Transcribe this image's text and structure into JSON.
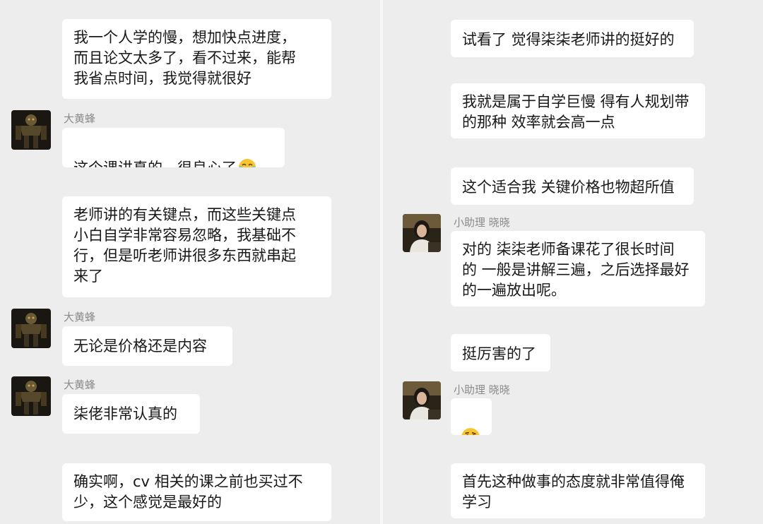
{
  "left": {
    "messages": [
      {
        "text": "我一个人学的慢，想加快点进度，\n而且论文太多了，看不过来，能帮\n我省点时间，我觉得就很好"
      },
      {
        "sender": "大黄蜂",
        "text": "这个课讲真的，很良心了",
        "emoji": "laughing-tears-emoji"
      },
      {
        "text": "老师讲的有关键点，而这些关键点\n小白自学非常容易忽略，我基础不\n行，但是听老师讲很多东西就串起\n来了"
      },
      {
        "sender": "大黄蜂",
        "text": "无论是价格还是内容"
      },
      {
        "sender": "大黄蜂",
        "text": "柒佬非常认真的"
      },
      {
        "text": "确实啊，cv 相关的课之前也买过不\n少，这个感觉是最好的"
      }
    ]
  },
  "right": {
    "messages": [
      {
        "text": "试看了 觉得柒柒老师讲的挺好的"
      },
      {
        "text": "我就是属于自学巨慢 得有人规划带\n的那种 效率就会高一点"
      },
      {
        "text": "这个适合我 关键价格也物超所值"
      },
      {
        "sender": "小助理 晓晓",
        "text": "对的 柒柒老师备课花了很长时间\n的 一般是讲解三遍，之后选择最好\n的一遍放出呢。"
      },
      {
        "text": "挺厉害的了"
      },
      {
        "sender": "小助理 晓晓",
        "emoji": "thinking-face-emoji"
      },
      {
        "text": "首先这种做事的态度就非常值得俺\n学习"
      }
    ]
  },
  "colors": {
    "background": "#ededed",
    "bubble": "#ffffff",
    "text": "#181818",
    "sender_name": "#8a8a8a"
  }
}
